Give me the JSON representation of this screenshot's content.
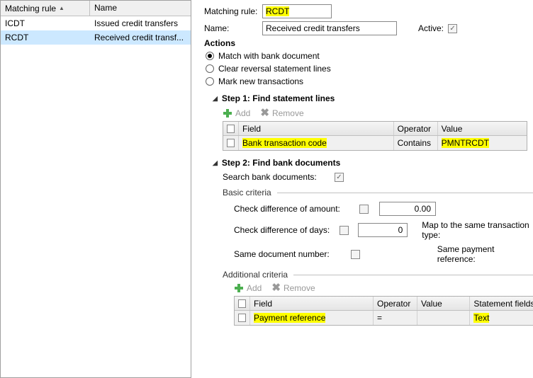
{
  "leftPane": {
    "headers": {
      "rule": "Matching rule",
      "name": "Name"
    },
    "rows": [
      {
        "rule": "ICDT",
        "name": "Issued credit transfers"
      },
      {
        "rule": "RCDT",
        "name": "Received credit transf..."
      }
    ],
    "selectedIndex": 1
  },
  "form": {
    "matchingRuleLabel": "Matching rule:",
    "matchingRuleValue": "RCDT",
    "nameLabel": "Name:",
    "nameValue": "Received credit transfers",
    "activeLabel": "Active:"
  },
  "actions": {
    "title": "Actions",
    "options": [
      "Match with bank document",
      "Clear reversal statement lines",
      "Mark new transactions"
    ],
    "selectedIndex": 0
  },
  "step1": {
    "title": "Step 1: Find statement lines",
    "addLabel": "Add",
    "removeLabel": "Remove",
    "headers": {
      "field": "Field",
      "operator": "Operator",
      "value": "Value"
    },
    "row": {
      "field": "Bank transaction code",
      "operator": "Contains",
      "value": "PMNTRCDT"
    }
  },
  "step2": {
    "title": "Step 2: Find bank documents",
    "searchLabel": "Search bank documents:",
    "basicTitle": "Basic criteria",
    "amountLabel": "Check difference of amount:",
    "amountValue": "0.00",
    "daysLabel": "Check difference of days:",
    "daysValue": "0",
    "mapLabel": "Map to the same transaction type:",
    "docNumLabel": "Same document number:",
    "payRefLabel": "Same payment reference:",
    "additionalTitle": "Additional criteria",
    "addLabel": "Add",
    "removeLabel": "Remove",
    "headers": {
      "field": "Field",
      "operator": "Operator",
      "value": "Value",
      "stmt": "Statement fields"
    },
    "row": {
      "field": "Payment reference",
      "operator": "=",
      "value": "",
      "stmt": "Text"
    }
  }
}
